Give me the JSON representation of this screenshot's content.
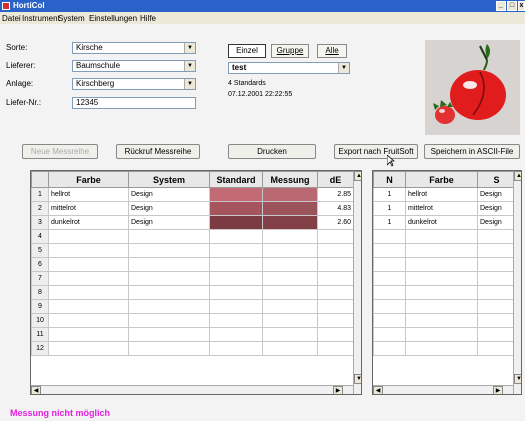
{
  "window": {
    "title": "HortiCol",
    "min": "_",
    "restore": "□",
    "close": "x"
  },
  "menu": [
    "Datei",
    "Instrument",
    "System",
    "Einstellungen",
    "Hilfe"
  ],
  "fields": {
    "sorte_label": "Sorte:",
    "sorte_value": "Kirsche",
    "lieferer_label": "Lieferer:",
    "lieferer_value": "Baumschule",
    "anlage_label": "Anlage:",
    "anlage_value": "Kirschberg",
    "liefer_nr_label": "Liefer-Nr.:",
    "liefer_nr_value": "12345"
  },
  "tabs": {
    "einzel": "Einzel",
    "gruppe": "Gruppe",
    "alle": "Alle"
  },
  "standard_select": "test",
  "standards_count": "4 Standards",
  "timestamp": "07.12.2001 22:22:55",
  "toolbar": {
    "neue": "Neue Messreihe",
    "rueckruf": "Rückruf Messreihe",
    "drucken": "Drucken",
    "export": "Export nach FruitSoft",
    "speichern": "Speichern in ASCII-File"
  },
  "main_table": {
    "headers": [
      "Farbe",
      "System",
      "Standard",
      "Messung",
      "dE"
    ],
    "row_numbers": [
      "1",
      "2",
      "3",
      "4",
      "5",
      "6",
      "7",
      "8",
      "9",
      "10",
      "11",
      "12"
    ],
    "rows": [
      {
        "farbe": "hellrot",
        "system": "Design",
        "de": "2.85",
        "std_color": "#c26b74",
        "mes_color": "#ba6871"
      },
      {
        "farbe": "mittelrot",
        "system": "Design",
        "de": "4.83",
        "std_color": "#a6555e",
        "mes_color": "#9c525a"
      },
      {
        "farbe": "dunkelrot",
        "system": "Design",
        "de": "2.60",
        "std_color": "#7c3b43",
        "mes_color": "#823f46"
      }
    ]
  },
  "side_table": {
    "headers": [
      "N",
      "Farbe",
      "S"
    ],
    "rows": [
      {
        "n": "1",
        "farbe": "hellrot",
        "s": "Design"
      },
      {
        "n": "1",
        "farbe": "mittelrot",
        "s": "Design"
      },
      {
        "n": "1",
        "farbe": "dunkelrot",
        "s": "Design"
      }
    ]
  },
  "status_message": "Messung nicht möglich"
}
